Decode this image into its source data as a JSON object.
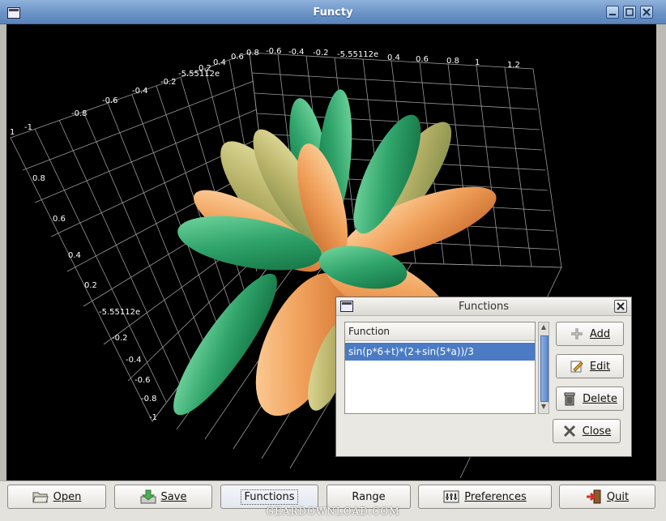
{
  "window": {
    "title": "Functy"
  },
  "axes_labels": {
    "top_row": [
      "0.8",
      "-0.6",
      "-0.4",
      "-0.2",
      "-5.55112e",
      "0.4",
      "0.6",
      "0.8",
      "1",
      "1.2"
    ],
    "top_left_row": [
      "0.6",
      "0.4",
      "0.2",
      "-5.55112e",
      "-0.2",
      "-0.4",
      "-0.6",
      "-0.8",
      "-1",
      "1"
    ],
    "left_col": [
      "0.8",
      "0.6",
      "0.4",
      "0.2",
      "-5.55112e",
      "-0.2",
      "-0.4",
      "-0.6",
      "-0.8",
      "-1"
    ]
  },
  "dialog": {
    "title": "Functions",
    "list_header": "Function",
    "functions": [
      "sin(p*6+t)*(2+sin(5*a))/3"
    ],
    "buttons": {
      "add": "Add",
      "edit": "Edit",
      "delete": "Delete",
      "close": "Close"
    }
  },
  "toolbar": {
    "open": "Open",
    "save": "Save",
    "functions": "Functions",
    "range": "Range",
    "preferences": "Preferences",
    "quit": "Quit"
  },
  "watermark": "GEARDOWNLOAD.COM",
  "colors": {
    "titlebar": "#6b93c6",
    "selection": "#4a7bc4",
    "petal_green": "#2fa36a",
    "petal_orange": "#f0a05a",
    "background": "#000000"
  }
}
